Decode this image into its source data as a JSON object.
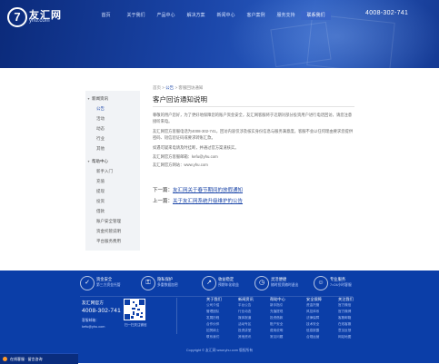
{
  "header": {
    "logo_mark": "7",
    "logo_name": "友汇网",
    "logo_sub": "yhu.com",
    "nav": [
      "首页",
      "关于我们",
      "产品中心",
      "解决方案",
      "新闻中心",
      "客户案例",
      "服务支持",
      "联系我们"
    ],
    "active_nav_index": 7,
    "hotline": "4008-302-741"
  },
  "sidebar": {
    "items": [
      {
        "label": "新闻资讯",
        "type": "cat",
        "active": false
      },
      {
        "label": "公告",
        "type": "sub",
        "active": true
      },
      {
        "label": "活动",
        "type": "sub",
        "active": false
      },
      {
        "label": "动态",
        "type": "sub",
        "active": false
      },
      {
        "label": "行业",
        "type": "sub",
        "active": false
      },
      {
        "label": "其他",
        "type": "sub",
        "active": false
      },
      {
        "label": "帮助中心",
        "type": "cat",
        "active": false
      },
      {
        "label": "新手入门",
        "type": "sub",
        "active": false
      },
      {
        "label": "充值",
        "type": "sub",
        "active": false
      },
      {
        "label": "提现",
        "type": "sub",
        "active": false
      },
      {
        "label": "投资",
        "type": "sub",
        "active": false
      },
      {
        "label": "借款",
        "type": "sub",
        "active": false
      },
      {
        "label": "账户安全管理",
        "type": "sub",
        "active": false
      },
      {
        "label": "资金托管说明",
        "type": "sub",
        "active": false
      },
      {
        "label": "平台服务费用",
        "type": "sub",
        "active": false
      },
      {
        "label": "风险保障说明",
        "type": "sub",
        "active": false
      },
      {
        "label": "名词解释",
        "type": "sub",
        "active": false
      },
      {
        "label": "常见问题",
        "type": "sub",
        "active": false
      }
    ]
  },
  "article": {
    "breadcrumb": [
      "首页",
      "公告",
      "客服回访通知"
    ],
    "breadcrumb_sep": ">",
    "title": "客户回访通知说明",
    "paragraphs": [
      "尊敬的用户您好，为了更好地保障您的账户资金安全，友汇网客服将于近期对部分投资用户进行电话回访，请您注意接听来电。",
      "友汇网官方客服电话为4008-302-741，回访内容仅涉及核实身份信息与服务满意度，客服不会以任何理由要求您提供密码、短信验证码或要求转账汇款。",
      "如遇可疑来电请及时挂断，并通过官方渠道核实。",
      "友汇网官方客服邮箱：kefu@yhu.com",
      "友汇网官方网站：www.yhu.com"
    ],
    "next_label": "下一篇：",
    "next_title": "友汇网关于春节期间的放假通知",
    "prev_label": "上一篇：",
    "prev_title": "关于友汇网系统升级维护的公告"
  },
  "footer": {
    "features": [
      {
        "icon": "shield-icon",
        "glyph": "✓",
        "title": "资金安全",
        "sub": "第三方资金托管"
      },
      {
        "icon": "lock-icon",
        "glyph": "⚿",
        "title": "隐私保护",
        "sub": "多重数据加密"
      },
      {
        "icon": "chart-icon",
        "glyph": "↗",
        "title": "收益稳定",
        "sub": "预期年化收益"
      },
      {
        "icon": "clock-icon",
        "glyph": "◷",
        "title": "灵活便捷",
        "sub": "随时投资随时退出"
      },
      {
        "icon": "user-icon",
        "glyph": "☺",
        "title": "专业服务",
        "sub": "7×24小时客服"
      }
    ],
    "brand": "友汇网官方",
    "phone": "4008-302-741",
    "mail_label": "客服邮箱：",
    "mail": "kefu@yhu.com",
    "qr_caption": "扫一扫关注微信",
    "columns": [
      {
        "head": "关于我们",
        "links": [
          "公司介绍",
          "管理团队",
          "发展历程",
          "合作伙伴",
          "招贤纳士",
          "联系我们"
        ]
      },
      {
        "head": "新闻资讯",
        "links": [
          "平台公告",
          "行业动态",
          "媒体报道",
          "活动专区",
          "投资讲堂",
          "其他资讯"
        ]
      },
      {
        "head": "帮助中心",
        "links": [
          "新手指引",
          "充值提现",
          "投资借款",
          "账户安全",
          "费用说明",
          "常见问题"
        ]
      },
      {
        "head": "安全保障",
        "links": [
          "资金托管",
          "风控体系",
          "法律保障",
          "技术安全",
          "信息披露",
          "合规运营"
        ]
      },
      {
        "head": "关注我们",
        "links": [
          "官方微信",
          "官方微博",
          "客服邮箱",
          "在线客服",
          "意见反馈",
          "网站地图"
        ]
      }
    ],
    "copyright": "Copyright © 友汇网 www.yhu.com 版权所有",
    "float_bar": "在线客服 · 留言咨询"
  }
}
